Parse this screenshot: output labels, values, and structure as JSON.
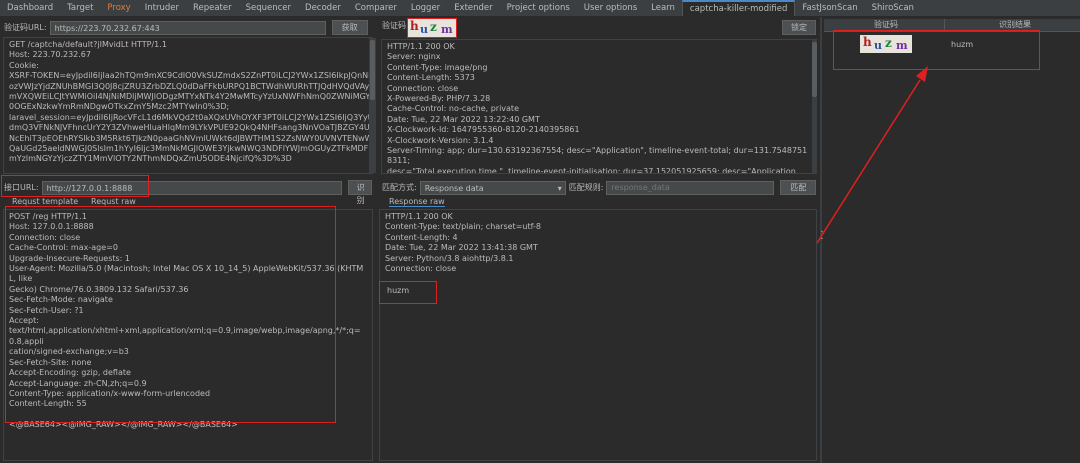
{
  "tabs": [
    "Dashboard",
    "Target",
    "Proxy",
    "Intruder",
    "Repeater",
    "Sequencer",
    "Decoder",
    "Comparer",
    "Logger",
    "Extender",
    "Project options",
    "User options",
    "Learn",
    "captcha-killer-modified",
    "FastJsonScan",
    "ShiroScan"
  ],
  "captcha_url": {
    "label": "验证码URL:",
    "value": "https://223.70.232.67:443",
    "button": "获取"
  },
  "captcha_label": "验证码:",
  "lock_button": "锁定",
  "captcha_text": "huzm",
  "request_top": [
    "GET /captcha/default?jIMvidLt HTTP/1.1",
    "Host: 223.70.232.67",
    "Cookie:",
    "XSRF-TOKEN=eyJpdiI6IjIaa2hTQm9mXC9CdlO0VkSUZmdxS2ZnPT0iLCJ2YWx1ZSI6IkpJQnNKZF",
    "ozVWJzYjdZNUhBMGI3Q0J8cjZRU3ZrbDZLQ0dDaFFkbURPQ1BCTWdhWURhTTJQdHVQdVAyb",
    "mVXQWEiLCJtYWMiOiI4NjNiMDljMWJlODgzMTYxNTk4Y2MwMTcyYzUxNWFhNmQ0ZWNiMGY",
    "0OGExNzkwYmRmNDgwOTkxZmY5Mzc2MTYwIn0%3D;",
    "laravel_session=eyJpdiI6IjRocVFcL1d6MkVQd2t0aXQxUVhOYXF3PT0iLCJ2YWx1ZSI6IjQ3YytMSk",
    "dmQ3VFNkNJVFhncUrY2Y3ZVhweHluaHlqMm9LYkVPUE92QkQ4NHFsang3NnVOaTJBZGY4UFN",
    "NcEhiT3pEOEhRYSIkb3M5Rkt6TJkzN0paaGhNVmlUWkt6dJBWTHM1S2ZsNWY0UVNVTENwWEI",
    "QaUGd25aeldNWGJ0SlsIm1hYyI6Ijc3MmNkMGJlOWE3YjkwNWQ3NDFlYWJmOGUyZTFkMDF",
    "mYzlmNGYzYjczZTY1MmVlOTY2NThmNDQxZmU5ODE4NjcifQ%3D%3D"
  ],
  "response_top": [
    "HTTP/1.1 200 OK",
    "Server: nginx",
    "Content-Type: image/png",
    "Content-Length: 5373",
    "Connection: close",
    "X-Powered-By: PHP/7.3.28",
    "Cache-Control: no-cache, private",
    "Date: Tue, 22 Mar 2022 13:22:40 GMT",
    "X-Clockwork-Id: 1647955360-8120-2140395861",
    "X-Clockwork-Version: 3.1.4",
    "Server-Timing: app; dur=130.63192367554; desc=\"Application\", timeline-event-total; dur=131.75487518311;",
    "desc=\"Total execution time.\", timeline-event-initialisation; dur=37.152051925659; desc=\"Application"
  ],
  "table": {
    "col1": "验证码",
    "col2": "识别结果",
    "rows": [
      {
        "result": "huzm"
      }
    ]
  },
  "api_url": {
    "label": "接口URL:",
    "value": "http://127.0.0.1:8888",
    "button": "识别"
  },
  "match": {
    "mode_label": "匹配方式:",
    "mode_value": "Response data",
    "rule_label": "匹配规则:",
    "rule_placeholder": "response_data",
    "button": "匹配"
  },
  "subtabs": {
    "template": "Requst template",
    "raw": "Requst raw",
    "response_raw": "Response raw"
  },
  "request_bottom": [
    "POST /reg HTTP/1.1",
    "Host: 127.0.0.1:8888",
    "Connection: close",
    "Cache-Control: max-age=0",
    "Upgrade-Insecure-Requests: 1",
    "User-Agent: Mozilla/5.0 (Macintosh; Intel Mac OS X 10_14_5) AppleWebKit/537.36 (KHTML, like",
    "Gecko) Chrome/76.0.3809.132 Safari/537.36",
    "Sec-Fetch-Mode: navigate",
    "Sec-Fetch-User: ?1",
    "Accept:",
    "text/html,application/xhtml+xml,application/xml;q=0.9,image/webp,image/apng,*/*;q=0.8,appli",
    "cation/signed-exchange;v=b3",
    "Sec-Fetch-Site: none",
    "Accept-Encoding: gzip, deflate",
    "Accept-Language: zh-CN,zh;q=0.9",
    "Content-Type: application/x-www-form-urlencoded",
    "Content-Length: 55",
    "",
    "<@BASE64><@IMG_RAW></@IMG_RAW></@BASE64>"
  ],
  "response_bottom": [
    "HTTP/1.1 200 OK",
    "Content-Type: text/plain; charset=utf-8",
    "Content-Length: 4",
    "Date: Tue, 22 Mar 2022 13:41:38 GMT",
    "Server: Python/3.8 aiohttp/3.8.1",
    "Connection: close"
  ],
  "response_body": "huzm",
  "colors": {
    "accent": "#e2793b",
    "highlight": "#e02020",
    "selection": "#4a88c7",
    "bg": "#2b2b2b"
  }
}
